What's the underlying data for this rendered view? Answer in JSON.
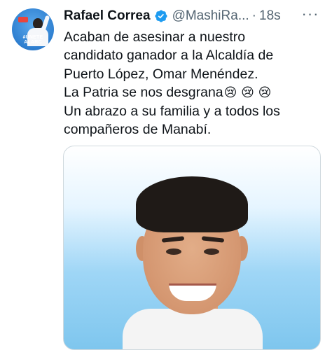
{
  "tweet": {
    "avatar": {
      "caption_line1": "#UNETE",
      "caption_line2": "ALARC"
    },
    "author": {
      "name": "Rafael Correa",
      "handle": "@MashiRa...",
      "separator": "·",
      "time": "18s"
    },
    "more_label": "···",
    "text": {
      "line1": "Acaban de asesinar a nuestro",
      "line2": "candidato ganador a la Alcaldía de",
      "line3": "Puerto López, Omar Menéndez.",
      "line4": "La Patria se nos desgrana",
      "line4_emojis": "😢 😢 😢",
      "line5": "Un abrazo a su familia y a todos los",
      "line6": "compañeros de Manabí."
    }
  },
  "colors": {
    "text_primary": "#0f1419",
    "text_secondary": "#536471",
    "verified_blue": "#1d9bf0",
    "media_border": "#cfd9de"
  },
  "icons": {
    "verified": "verified-badge-icon",
    "more": "more-options-icon"
  }
}
